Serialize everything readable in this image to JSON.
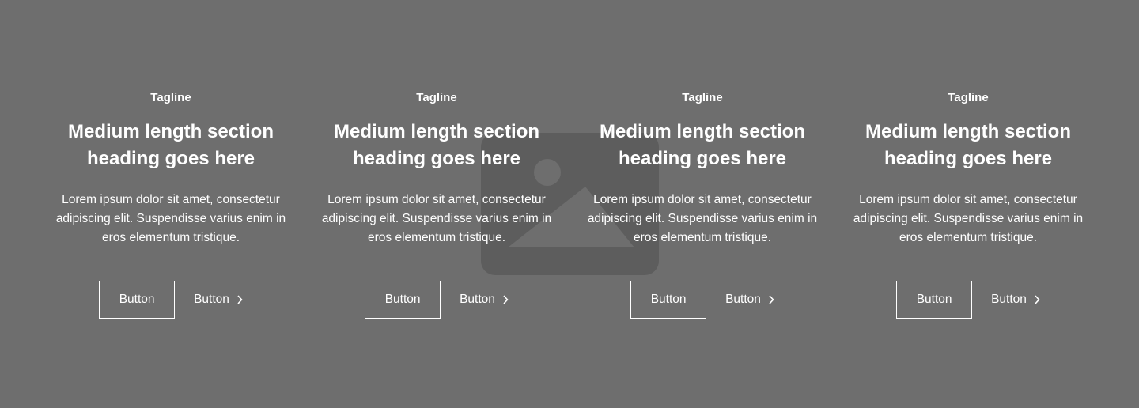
{
  "background_color": "#6e6e6e",
  "text_color": "#ffffff",
  "background_image_icon": "image-placeholder-icon",
  "columns": [
    {
      "tagline": "Tagline",
      "heading": "Medium length section heading goes here",
      "body": "Lorem ipsum dolor sit amet, consectetur adipiscing elit. Suspendisse varius enim in eros elementum tristique.",
      "primary_button": "Button",
      "secondary_button": "Button"
    },
    {
      "tagline": "Tagline",
      "heading": "Medium length section heading goes here",
      "body": "Lorem ipsum dolor sit amet, consectetur adipiscing elit. Suspendisse varius enim in eros elementum tristique.",
      "primary_button": "Button",
      "secondary_button": "Button"
    },
    {
      "tagline": "Tagline",
      "heading": "Medium length section heading goes here",
      "body": "Lorem ipsum dolor sit amet, consectetur adipiscing elit. Suspendisse varius enim in eros elementum tristique.",
      "primary_button": "Button",
      "secondary_button": "Button"
    },
    {
      "tagline": "Tagline",
      "heading": "Medium length section heading goes here",
      "body": "Lorem ipsum dolor sit amet, consectetur adipiscing elit. Suspendisse varius enim in eros elementum tristique.",
      "primary_button": "Button",
      "secondary_button": "Button"
    }
  ]
}
